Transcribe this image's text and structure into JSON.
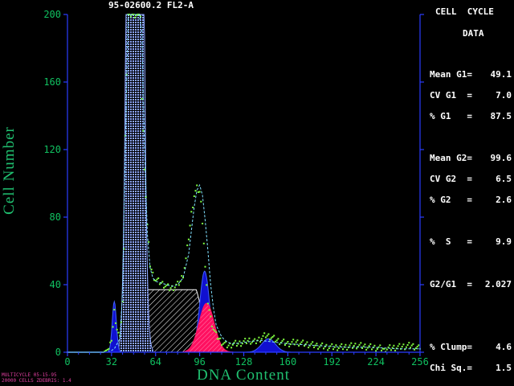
{
  "chart_data": {
    "type": "histogram",
    "title": "95-02600.2 FL2-A",
    "xlabel": "DNA Content",
    "ylabel": "Cell Number",
    "xlim": [
      0,
      256
    ],
    "ylim": [
      0,
      200
    ],
    "x_ticks": [
      0,
      32,
      64,
      96,
      128,
      160,
      192,
      224,
      256
    ],
    "y_ticks": [
      0,
      40,
      80,
      120,
      160,
      200
    ],
    "series": [
      {
        "kind": "histogram",
        "x": [
          0,
          20,
          26,
          28,
          30,
          31,
          32,
          33,
          34,
          36,
          38,
          40,
          41,
          42,
          44,
          46,
          48,
          50,
          52,
          53,
          54,
          56,
          58,
          60,
          62,
          64,
          66,
          68,
          70,
          72,
          74,
          76,
          78,
          80,
          82,
          84,
          86,
          88,
          90,
          92,
          94,
          96,
          97,
          98,
          99,
          100,
          101,
          102,
          104,
          106,
          108,
          110,
          112,
          114,
          116,
          118,
          120,
          124,
          128,
          132,
          136,
          140,
          144,
          148,
          152,
          156,
          160,
          166,
          172,
          180,
          190,
          200,
          210,
          220,
          230,
          240,
          250,
          256
        ],
        "y": [
          0,
          0,
          0,
          1,
          2,
          4,
          8,
          15,
          24,
          14,
          8,
          30,
          60,
          130,
          200,
          200,
          200,
          200,
          200,
          200,
          150,
          110,
          75,
          52,
          46,
          43,
          42,
          41,
          40,
          39,
          38,
          38,
          39,
          40,
          42,
          46,
          55,
          68,
          82,
          93,
          97,
          95,
          88,
          78,
          65,
          50,
          38,
          30,
          20,
          14,
          10,
          8,
          6,
          5,
          4,
          4,
          5,
          5,
          6,
          7,
          6,
          8,
          10,
          9,
          7,
          6,
          5,
          6,
          5,
          4,
          3,
          3,
          4,
          3,
          2,
          3,
          4,
          2
        ]
      },
      {
        "kind": "fit",
        "x": [
          0,
          30,
          34,
          38,
          40,
          42,
          44,
          46,
          48,
          49,
          50,
          52,
          54,
          56,
          58,
          60,
          62,
          64,
          68,
          72,
          76,
          80,
          84,
          88,
          90,
          92,
          94,
          96,
          98,
          100,
          102,
          104,
          106,
          108,
          112,
          116,
          120,
          130,
          140,
          150,
          160,
          180,
          200,
          220,
          240,
          256
        ],
        "y": [
          0,
          0,
          2,
          8,
          35,
          120,
          200,
          200,
          200,
          200,
          200,
          200,
          190,
          120,
          70,
          50,
          44,
          42,
          41,
          40,
          39,
          40,
          44,
          58,
          72,
          86,
          96,
          99,
          93,
          78,
          60,
          40,
          26,
          16,
          9,
          6,
          5,
          6,
          7,
          6,
          5,
          4,
          3,
          3,
          2,
          2
        ]
      },
      {
        "kind": "G1",
        "mean": 49.1,
        "cv": 7.0,
        "percent": 87.5
      },
      {
        "kind": "G2",
        "mean": 99.6,
        "cv": 6.5,
        "percent": 2.6
      },
      {
        "kind": "S",
        "percent": 9.9
      }
    ]
  },
  "stats": {
    "heading1": "CELL  CYCLE",
    "heading2": "DATA",
    "lines": [
      {
        "label": "Mean G1=",
        "value": "49.1"
      },
      {
        "label": "CV G1  =",
        "value": "7.0"
      },
      {
        "label": "% G1   =",
        "value": "87.5"
      },
      {
        "label": "Mean G2=",
        "value": "99.6"
      },
      {
        "label": "CV G2  =",
        "value": "6.5"
      },
      {
        "label": "% G2   =",
        "value": "2.6"
      },
      {
        "label": "%  S   =",
        "value": "9.9"
      },
      {
        "label": "G2/G1  =",
        "value": "2.027"
      },
      {
        "label": "% Clump=",
        "value": "4.6"
      },
      {
        "label": "Chi Sq.=",
        "value": "1.5"
      }
    ]
  },
  "footer": {
    "line1": "MULTICYCLE 05-15-95",
    "line2": "20000 CELLS ZDEBRIS: 1.4"
  },
  "colors": {
    "axis": "#2a3cff",
    "tick_label": "#10c060",
    "axis_title": "#20c070",
    "g1_fill": "#8fa8ff",
    "g2_fill": "#1010d0",
    "s_phase": "#ffffff",
    "red": "#ff1060",
    "points": "#80ff40",
    "footer": "#e040a0"
  }
}
